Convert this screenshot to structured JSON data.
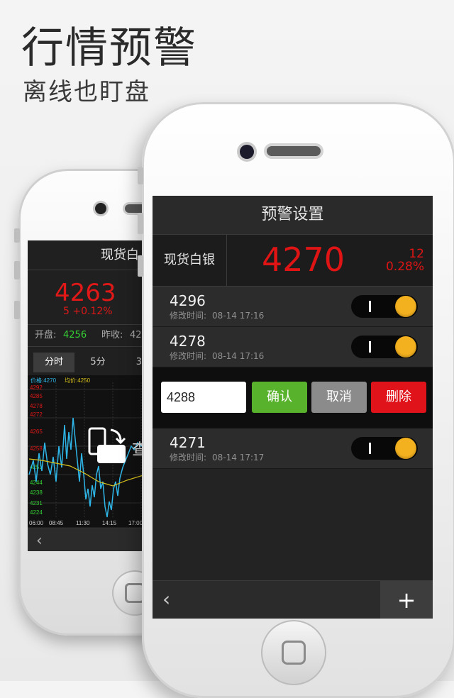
{
  "promo": {
    "headline": "行情预警",
    "subline": "离线也盯盘"
  },
  "back_screen": {
    "title": "现货白",
    "price": "4263",
    "change": "5 +0.12%",
    "stats": {
      "open_label": "开盘:",
      "open_value": "4256",
      "prev_label": "昨收:",
      "prev_value": "42"
    },
    "tabs": [
      "分时",
      "5分",
      "30"
    ],
    "chart_info": {
      "price_label": "价格:4270",
      "avg_label": "均价:4250"
    },
    "y_ticks_red": [
      "4292",
      "4285",
      "4278",
      "4272",
      "4265",
      "4258"
    ],
    "y_ticks_green": [
      "4251",
      "4244",
      "4238",
      "4231",
      "4224"
    ],
    "x_ticks": [
      "06:00",
      "08:45",
      "11:30",
      "14:15",
      "17:00"
    ],
    "overlay_text": "查",
    "colors": {
      "price_up": "#e01818",
      "price_down": "#34d134",
      "line": "#2fb6e8",
      "avg": "#d8c21c"
    }
  },
  "screen": {
    "title": "预警设置",
    "instrument": "现货白银",
    "price": "4270",
    "change_abs": "12",
    "change_pct": "0.28%",
    "alerts": [
      {
        "value": "4296",
        "meta_label": "修改时间:",
        "time": "08-14 17:16",
        "enabled": true
      },
      {
        "value": "4278",
        "meta_label": "修改时间:",
        "time": "08-14 17:16",
        "enabled": true
      },
      {
        "value": "4271",
        "meta_label": "修改时间:",
        "time": "08-14 17:17",
        "enabled": true
      }
    ],
    "editor": {
      "input_value": "4288",
      "confirm": "确认",
      "cancel": "取消",
      "delete": "删除"
    },
    "footer": {
      "back_icon": "chevron-left-icon",
      "add_icon": "plus-icon",
      "back_glyph": "‹",
      "add_glyph": "+"
    },
    "colors": {
      "price": "#e01414",
      "toggle_knob": "#f4b11f",
      "confirm": "#59b22c",
      "cancel": "#8b8b8b",
      "delete": "#e0131b"
    }
  }
}
